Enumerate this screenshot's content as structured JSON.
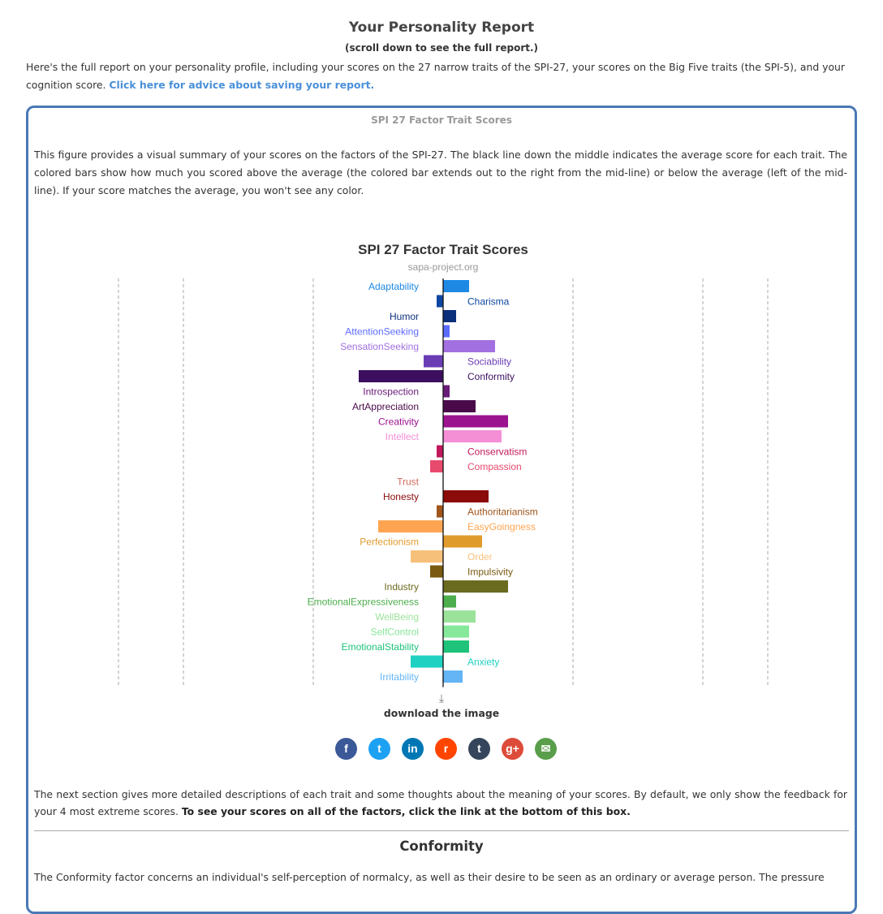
{
  "page": {
    "title": "Your Personality Report",
    "subtitle": "(scroll down to see the full report.)",
    "intro_text": "Here's the full report on your personality profile, including your scores on the 27 narrow traits of the SPI-27, your scores on the Big Five traits (the SPI-5), and your cognition score. ",
    "intro_link": "Click here for advice about saving your report."
  },
  "box": {
    "title": "SPI 27 Factor Trait Scores",
    "description": "This figure provides a visual summary of your scores on the factors of the SPI-27. The black line down the middle indicates the average score for each trait. The colored bars show how much you scored above the average (the colored bar extends out to the right from the mid-line) or below the average (left of the mid-line). If your score matches the average, you won't see any color.",
    "download_icon": "download-icon",
    "download_label": "download the image",
    "share_buttons": [
      {
        "name": "facebook",
        "glyph": "f",
        "color": "#3b5998"
      },
      {
        "name": "twitter",
        "glyph": "t",
        "color": "#1da1f2"
      },
      {
        "name": "linkedin",
        "glyph": "in",
        "color": "#0077b5"
      },
      {
        "name": "reddit",
        "glyph": "r",
        "color": "#ff4500"
      },
      {
        "name": "tumblr",
        "glyph": "t",
        "color": "#35465c"
      },
      {
        "name": "google-plus",
        "glyph": "g+",
        "color": "#dd4b39"
      },
      {
        "name": "email",
        "glyph": "✉",
        "color": "#5a9e4b"
      }
    ],
    "bottom_text": "The next section gives more detailed descriptions of each trait and some thoughts about the meaning of your scores. By default, we only show the feedback for your 4 most extreme scores. ",
    "bottom_bold": "To see your scores on all of the factors, click the link at the bottom of this box.",
    "section_title": "Conformity",
    "section_text": "The Conformity factor concerns an individual's self-perception of normalcy, as well as their desire to be seen as an ordinary or average person. The pressure"
  },
  "chart_data": {
    "type": "bar",
    "orientation": "horizontal-diverging",
    "title": "SPI 27 Factor Trait Scores",
    "subtitle": "sapa-project.org",
    "baseline": 0,
    "xlim": [
      -5,
      5
    ],
    "grid_lines_at": [
      -5,
      -4,
      -2,
      2,
      4,
      5
    ],
    "categories": [
      "Adaptability",
      "Charisma",
      "Humor",
      "AttentionSeeking",
      "SensationSeeking",
      "Sociability",
      "Conformity",
      "Introspection",
      "ArtAppreciation",
      "Creativity",
      "Intellect",
      "Conservatism",
      "Compassion",
      "Trust",
      "Honesty",
      "Authoritarianism",
      "EasyGoingness",
      "Perfectionism",
      "Order",
      "Impulsivity",
      "Industry",
      "EmotionalExpressiveness",
      "WellBeing",
      "SelfControl",
      "EmotionalStability",
      "Anxiety",
      "Irritability"
    ],
    "values": [
      0.4,
      -0.1,
      0.2,
      0.1,
      0.8,
      -0.3,
      -1.3,
      0.1,
      0.5,
      1.0,
      0.9,
      -0.1,
      -0.2,
      0,
      0.7,
      -0.1,
      -1.0,
      0.6,
      -0.5,
      -0.2,
      1.0,
      0.2,
      0.5,
      0.4,
      0.4,
      -0.5,
      0.3
    ],
    "colors": [
      "#1e88e5",
      "#0d47a1",
      "#0b2f7a",
      "#5c6bff",
      "#a270e0",
      "#6a3db5",
      "#3b0f5e",
      "#6a1b7a",
      "#4a0a4a",
      "#9c1390",
      "#f48fd6",
      "#c2185b",
      "#e84a6e",
      "#d26a5c",
      "#8b0a0a",
      "#a0551a",
      "#ffa552",
      "#e09b2d",
      "#f7c07a",
      "#7a5a10",
      "#6b6b20",
      "#4cae4c",
      "#9be39b",
      "#86e89b",
      "#1fc47a",
      "#1fd1c0",
      "#64b5f6"
    ],
    "label_side": [
      "left",
      "right",
      "left",
      "left",
      "left",
      "right",
      "right",
      "left",
      "left",
      "left",
      "left",
      "right",
      "right",
      "left",
      "left",
      "right",
      "right",
      "left",
      "right",
      "right",
      "left",
      "left",
      "left",
      "left",
      "left",
      "right",
      "left"
    ]
  }
}
